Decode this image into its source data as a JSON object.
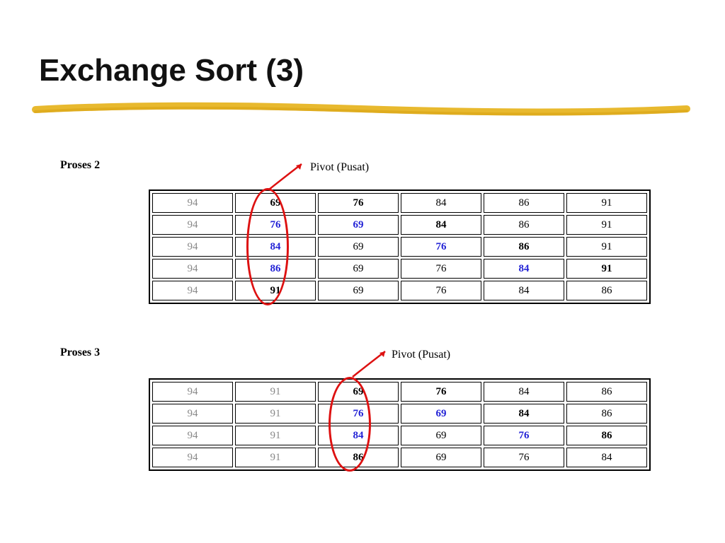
{
  "title": "Exchange Sort (3)",
  "process2": {
    "label": "Proses 2",
    "pivot_label": "Pivot (Pusat)",
    "rows": [
      [
        {
          "v": "94",
          "c": "gray"
        },
        {
          "v": "69",
          "c": "bold"
        },
        {
          "v": "76",
          "c": "bold"
        },
        {
          "v": "84",
          "c": "black"
        },
        {
          "v": "86",
          "c": "black"
        },
        {
          "v": "91",
          "c": "black"
        }
      ],
      [
        {
          "v": "94",
          "c": "gray"
        },
        {
          "v": "76",
          "c": "blue"
        },
        {
          "v": "69",
          "c": "blue"
        },
        {
          "v": "84",
          "c": "bold"
        },
        {
          "v": "86",
          "c": "black"
        },
        {
          "v": "91",
          "c": "black"
        }
      ],
      [
        {
          "v": "94",
          "c": "gray"
        },
        {
          "v": "84",
          "c": "blue"
        },
        {
          "v": "69",
          "c": "black"
        },
        {
          "v": "76",
          "c": "blue"
        },
        {
          "v": "86",
          "c": "bold"
        },
        {
          "v": "91",
          "c": "black"
        }
      ],
      [
        {
          "v": "94",
          "c": "gray"
        },
        {
          "v": "86",
          "c": "blue"
        },
        {
          "v": "69",
          "c": "black"
        },
        {
          "v": "76",
          "c": "black"
        },
        {
          "v": "84",
          "c": "blue"
        },
        {
          "v": "91",
          "c": "bold"
        }
      ],
      [
        {
          "v": "94",
          "c": "gray"
        },
        {
          "v": "91",
          "c": "bold"
        },
        {
          "v": "69",
          "c": "black"
        },
        {
          "v": "76",
          "c": "black"
        },
        {
          "v": "84",
          "c": "black"
        },
        {
          "v": "86",
          "c": "black"
        }
      ]
    ]
  },
  "process3": {
    "label": "Proses 3",
    "pivot_label": "Pivot (Pusat)",
    "rows": [
      [
        {
          "v": "94",
          "c": "gray"
        },
        {
          "v": "91",
          "c": "gray"
        },
        {
          "v": "69",
          "c": "bold"
        },
        {
          "v": "76",
          "c": "bold"
        },
        {
          "v": "84",
          "c": "black"
        },
        {
          "v": "86",
          "c": "black"
        }
      ],
      [
        {
          "v": "94",
          "c": "gray"
        },
        {
          "v": "91",
          "c": "gray"
        },
        {
          "v": "76",
          "c": "blue"
        },
        {
          "v": "69",
          "c": "blue"
        },
        {
          "v": "84",
          "c": "bold"
        },
        {
          "v": "86",
          "c": "black"
        }
      ],
      [
        {
          "v": "94",
          "c": "gray"
        },
        {
          "v": "91",
          "c": "gray"
        },
        {
          "v": "84",
          "c": "blue"
        },
        {
          "v": "69",
          "c": "black"
        },
        {
          "v": "76",
          "c": "blue"
        },
        {
          "v": "86",
          "c": "bold"
        }
      ],
      [
        {
          "v": "94",
          "c": "gray"
        },
        {
          "v": "91",
          "c": "gray"
        },
        {
          "v": "86",
          "c": "bold"
        },
        {
          "v": "69",
          "c": "black"
        },
        {
          "v": "76",
          "c": "black"
        },
        {
          "v": "84",
          "c": "black"
        }
      ]
    ]
  }
}
